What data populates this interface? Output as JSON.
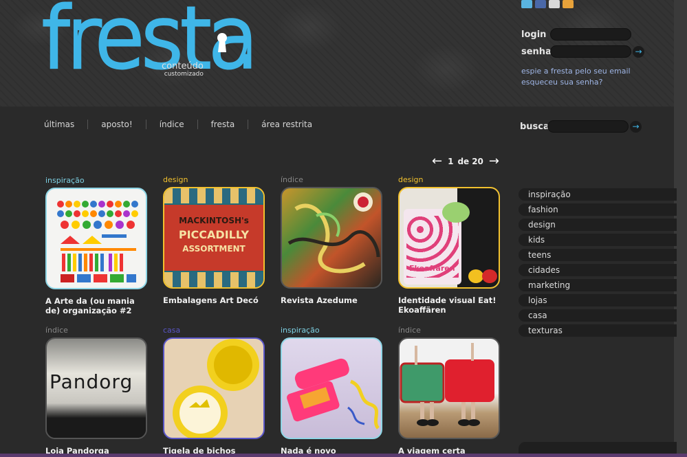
{
  "brand": {
    "logo_text": "fresta",
    "tagline_1": "conteúdo",
    "tagline_2": "customizado",
    "accent": "#3fb6e8"
  },
  "social_icons": [
    "twitter-icon",
    "facebook-icon",
    "email-icon",
    "rss-icon"
  ],
  "login": {
    "login_label": "login",
    "senha_label": "senha",
    "login_value": "",
    "senha_value": "",
    "link_email": "espie a fresta pelo seu email",
    "link_forgot": "esqueceu sua senha?"
  },
  "nav": [
    "últimas",
    "aposto!",
    "índice",
    "fresta",
    "área restrita"
  ],
  "search": {
    "label": "busca",
    "value": ""
  },
  "pager": {
    "current": "1",
    "sep": "de",
    "total": "20"
  },
  "posts": [
    {
      "category": "inspiração",
      "title": "A Arte da (ou mania de) organização #2",
      "cat_color": "#7fd3e6",
      "border": "#8fd6e6"
    },
    {
      "category": "design",
      "title": "Embalagens Art Decó",
      "cat_color": "#f2c12e",
      "border": "#f2c12e"
    },
    {
      "category": "índice",
      "title": "Revista Azedume",
      "cat_color": "#888888",
      "border": "#666666"
    },
    {
      "category": "design",
      "title": "Identidade visual Eat! Ekoaffären",
      "cat_color": "#f2c12e",
      "border": "#f2c12e"
    },
    {
      "category": "índice",
      "title": "Loja Pandorga",
      "cat_color": "#888888",
      "border": "#666666"
    },
    {
      "category": "casa",
      "title": "Tigela de bichos",
      "cat_color": "#5a56c8",
      "border": "#5a56c8"
    },
    {
      "category": "inspiração",
      "title": "Nada é novo",
      "cat_color": "#7fd3e6",
      "border": "#8fd6e6"
    },
    {
      "category": "índice",
      "title": "A viagem certa",
      "cat_color": "#888888",
      "border": "#666666"
    }
  ],
  "thumb_texts": {
    "mackintosh_1": "MACKINTOSH's",
    "mackintosh_2": "PICCADILLY",
    "mackintosh_3": "ASSORTMENT",
    "pandorga": "Pandorg",
    "ekoaffaren": "Ekoaffären"
  },
  "categories": [
    "inspiração",
    "fashion",
    "design",
    "kids",
    "teens",
    "cidades",
    "marketing",
    "lojas",
    "casa",
    "texturas"
  ]
}
